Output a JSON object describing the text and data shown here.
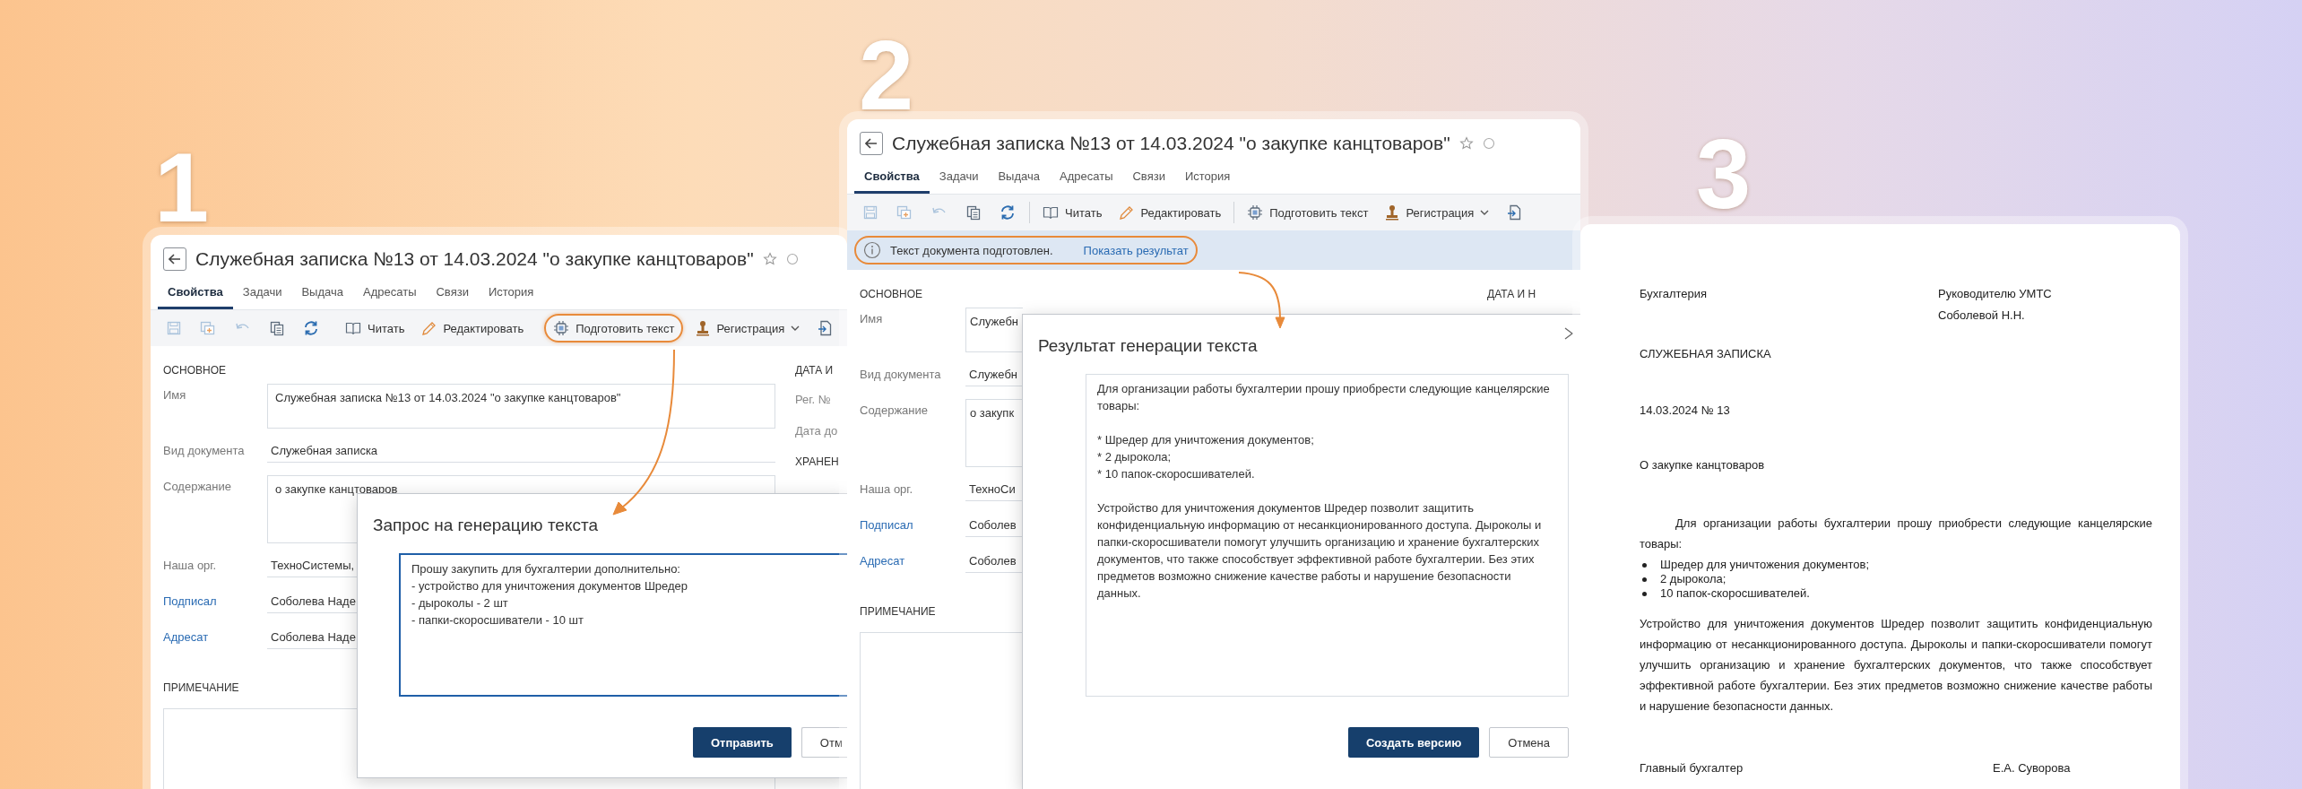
{
  "panels": [
    {
      "kind": "form",
      "step": "1",
      "title": "Служебная записка №13 от 14.03.2024 \"о закупке канцтоваров\"",
      "tabs": [
        {
          "label": "Свойства",
          "selected": true
        },
        {
          "label": "Задачи",
          "selected": false
        },
        {
          "label": "Выдача",
          "selected": false
        },
        {
          "label": "Адресаты",
          "selected": false
        },
        {
          "label": "Связи",
          "selected": false
        },
        {
          "label": "История",
          "selected": false
        }
      ],
      "toolbar": [
        {
          "kind": "save",
          "disabled": true
        },
        {
          "kind": "save_as",
          "disabled": true
        },
        {
          "kind": "undo",
          "disabled": true
        },
        {
          "kind": "copy",
          "disabled": false
        },
        {
          "kind": "refresh",
          "disabled": false
        },
        {
          "kind": "separator"
        },
        {
          "kind": "read",
          "label": "Читать"
        },
        {
          "kind": "edit",
          "label": "Редактировать"
        },
        {
          "kind": "separator"
        },
        {
          "kind": "ai",
          "label": "Подготовить текст",
          "highlighted": true
        },
        {
          "kind": "register",
          "label": "Регистрация",
          "dropdown": true
        },
        {
          "kind": "export",
          "disabled": false
        }
      ],
      "form": {
        "section": "ОСНОВНОЕ",
        "fields": [
          {
            "label": "Имя",
            "value": "Служебная записка №13 от 14.03.2024 \"о закупке канцтоваров\"",
            "kind": "area",
            "link": false
          },
          {
            "label": "Вид документа",
            "value": "Служебная записка",
            "kind": "line",
            "link": false
          },
          {
            "label": "Содержание",
            "value": "о закупке канцтоваров",
            "kind": "area",
            "link": false
          },
          {
            "label": "Наша орг.",
            "value": "ТехноСистемы,",
            "kind": "line",
            "link": false
          },
          {
            "label": "Подписал",
            "value": "Соболева Наде",
            "kind": "line",
            "link": true
          },
          {
            "label": "Адресат",
            "value": "Соболева Наде",
            "kind": "line",
            "link": true
          }
        ],
        "note_section": "ПРИМЕЧАНИЕ"
      },
      "side": {
        "heading": "ДАТА И",
        "labels": [
          "Рег. №",
          "Дата до"
        ],
        "heading_2": "ХРАНЕН"
      },
      "dialog": {
        "title": "Запрос на генерацию текста",
        "text": "Прошу закупить для бухгалтерии дополнительно:\n- устройство для уничтожения документов Шредер\n- дыроколы - 2 шт\n- папки-скоросшиватели - 10 шт",
        "focused": true,
        "closable": false,
        "buttons": [
          {
            "label": "Отправить",
            "kind": "primary"
          },
          {
            "label": "Отм",
            "kind": "secondary"
          }
        ]
      }
    },
    {
      "kind": "form",
      "step": "2",
      "title": "Служебная записка №13 от 14.03.2024 \"о закупке канцтоваров\"",
      "tabs": [
        {
          "label": "Свойства",
          "selected": true
        },
        {
          "label": "Задачи",
          "selected": false
        },
        {
          "label": "Выдача",
          "selected": false
        },
        {
          "label": "Адресаты",
          "selected": false
        },
        {
          "label": "Связи",
          "selected": false
        },
        {
          "label": "История",
          "selected": false
        }
      ],
      "toolbar": [
        {
          "kind": "save",
          "disabled": true
        },
        {
          "kind": "save_as",
          "disabled": true
        },
        {
          "kind": "undo",
          "disabled": true
        },
        {
          "kind": "copy",
          "disabled": false
        },
        {
          "kind": "refresh",
          "disabled": false
        },
        {
          "kind": "separator"
        },
        {
          "kind": "read",
          "label": "Читать"
        },
        {
          "kind": "edit",
          "label": "Редактировать"
        },
        {
          "kind": "separator"
        },
        {
          "kind": "ai",
          "label": "Подготовить текст",
          "highlighted": false
        },
        {
          "kind": "register",
          "label": "Регистрация",
          "dropdown": true
        },
        {
          "kind": "export",
          "disabled": false
        }
      ],
      "info": {
        "message": "Текст документа подготовлен.",
        "link": "Показать результат",
        "highlighted": true
      },
      "form": {
        "section": "ОСНОВНОЕ",
        "fields": [
          {
            "label": "Имя",
            "value": "Служебн",
            "kind": "area",
            "link": false
          },
          {
            "label": "Вид документа",
            "value": "Служебн",
            "kind": "line",
            "link": false
          },
          {
            "label": "Содержание",
            "value": "о закупк",
            "kind": "area",
            "link": false
          },
          {
            "label": "Наша орг.",
            "value": "ТехноСи",
            "kind": "line",
            "link": false
          },
          {
            "label": "Подписал",
            "value": "Соболев",
            "kind": "line",
            "link": true
          },
          {
            "label": "Адресат",
            "value": "Соболев",
            "kind": "line",
            "link": true
          }
        ],
        "note_section": "ПРИМЕЧАНИЕ"
      },
      "side": {
        "heading": "ДАТА И Н"
      },
      "dialog": {
        "title": "Результат генерации текста",
        "text": "Для организации работы бухгалтерии прошу приобрести следующие канцелярские товары:\n\n* Шредер для уничтожения документов;\n* 2 дырокола;\n* 10 папок-скоросшивателей.\n\nУстройство для уничтожения документов Шредер позволит защитить конфиденциальную информацию от несанкционированного доступа. Дыроколы и папки-скоросшиватели помогут улучшить организацию и хранение бухгалтерских документов, что также способствует эффективной работе бухгалтерии. Без этих предметов возможно снижение качестве работы и нарушение безопасности данных.",
        "focused": false,
        "closable": true,
        "buttons": [
          {
            "label": "Создать версию",
            "kind": "primary"
          },
          {
            "label": "Отмена",
            "kind": "secondary"
          }
        ]
      }
    },
    {
      "kind": "document",
      "step": "3",
      "document": {
        "from": "Бухгалтерия",
        "to": [
          "Руководителю УМТС",
          "Соболевой Н.Н."
        ],
        "heading": "СЛУЖЕБНАЯ ЗАПИСКА",
        "date_number": "14.03.2024 № 13",
        "subject": "О закупке канцтоваров",
        "intro": "Для организации работы бухгалтерии прошу приобрести следующие канцелярские товары:",
        "items": [
          "Шредер для уничтожения документов;",
          "2 дырокола;",
          "10 папок-скоросшивателей."
        ],
        "body": "Устройство для уничтожения документов Шредер позволит защитить конфиденциальную информацию от несанкционированного доступа. Дыроколы и папки-скоросшиватели помогут улучшить организацию и хранение бухгалтерских документов, что также способствует эффективной работе бухгалтерии. Без этих предметов возможно снижение качестве работы и нарушение безопасности данных.",
        "signature_title": "Главный бухгалтер",
        "signature_name": "Е.А. Суворова"
      }
    }
  ]
}
